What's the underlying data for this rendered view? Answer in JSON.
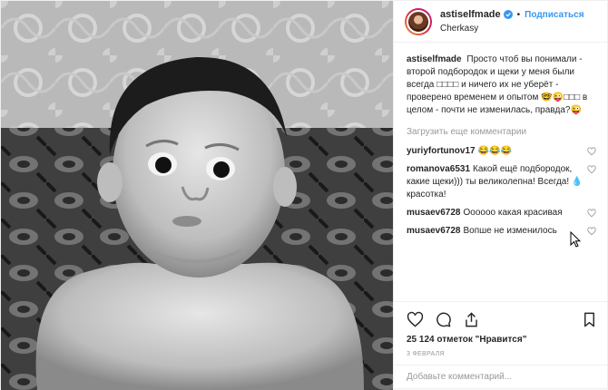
{
  "header": {
    "username": "astiselfmade",
    "follow_label": "Подписаться",
    "dot": "•",
    "location": "Cherkasy"
  },
  "caption": {
    "username": "astiselfmade",
    "text": "Просто чтоб вы понимали - второй подбородок и щеки у меня были всегда □□□□ и ничего их не уберёт - проверено временем и опытом 🤓😜□□□ в целом - почти не изменилась, правда?😜"
  },
  "load_more": "Загрузить еще комментарии",
  "comments": [
    {
      "user": "yuriyfortunov17",
      "text": "😂😂😂"
    },
    {
      "user": "romanova6531",
      "text": "Какой ещё подбородок, какие щеки))) ты великолепна! Всегда! 💧 красотка!"
    },
    {
      "user": "musaev6728",
      "text": "Оооооо какая красивая"
    },
    {
      "user": "musaev6728",
      "text": "Вопше не изменилось"
    }
  ],
  "likes": "25 124 отметок \"Нравится\"",
  "date": "3 ФЕВРАЛЯ",
  "add_comment_placeholder": "Добавьте комментарий...",
  "colors": {
    "accent": "#3897f0",
    "muted": "#999999",
    "text": "#262626"
  },
  "icons": [
    "verified-icon",
    "heart-icon",
    "comment-icon",
    "share-icon",
    "bookmark-icon"
  ]
}
